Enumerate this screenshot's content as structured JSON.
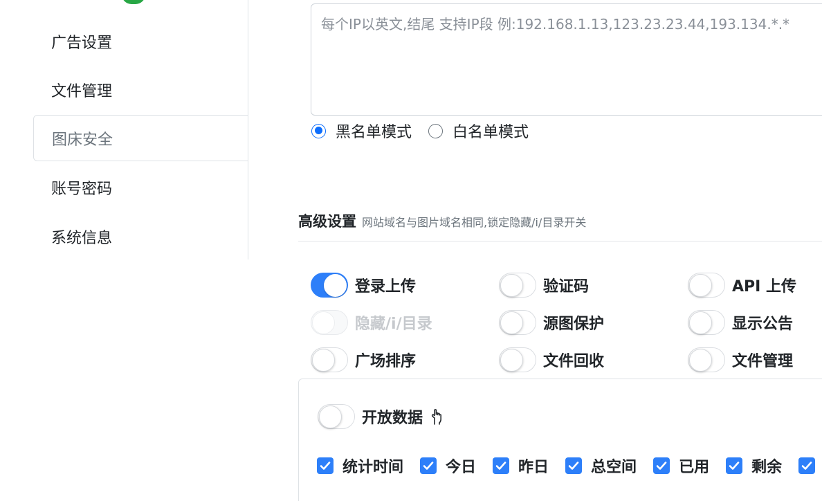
{
  "sidebar": {
    "items": [
      {
        "label": "广告设置"
      },
      {
        "label": "文件管理"
      },
      {
        "label": "图床安全",
        "active": true
      },
      {
        "label": "账号密码"
      },
      {
        "label": "系统信息"
      }
    ]
  },
  "ip_blacklist": {
    "placeholder": "每个IP以英文,结尾 支持IP段 例:192.168.1.13,123.23.23.44,193.134.*.*",
    "value": ""
  },
  "list_mode": {
    "options": [
      {
        "label": "黑名单模式",
        "checked": true
      },
      {
        "label": "白名单模式",
        "checked": false
      }
    ]
  },
  "advanced": {
    "title": "高级设置",
    "subtitle": "网站域名与图片域名相同,锁定隐藏/i/目录开关",
    "switches": [
      {
        "label": "登录上传",
        "on": true,
        "disabled": false
      },
      {
        "label": "验证码",
        "on": false,
        "disabled": false
      },
      {
        "label": "API 上传",
        "on": false,
        "disabled": false
      },
      {
        "label": "隐藏/i/目录",
        "on": false,
        "disabled": true
      },
      {
        "label": "源图保护",
        "on": false,
        "disabled": false
      },
      {
        "label": "显示公告",
        "on": false,
        "disabled": false
      },
      {
        "label": "广场排序",
        "on": false,
        "disabled": false
      },
      {
        "label": "文件回收",
        "on": false,
        "disabled": false
      },
      {
        "label": "文件管理",
        "on": false,
        "disabled": false
      }
    ]
  },
  "open_data": {
    "label": "开放数据",
    "on": false,
    "icon": "pointer-hand-icon",
    "checkboxes": [
      {
        "label": "统计时间",
        "checked": true
      },
      {
        "label": "今日",
        "checked": true
      },
      {
        "label": "昨日",
        "checked": true
      },
      {
        "label": "总空间",
        "checked": true
      },
      {
        "label": "已用",
        "checked": true
      },
      {
        "label": "剩余",
        "checked": true
      },
      {
        "label": "",
        "checked": true
      }
    ]
  },
  "colors": {
    "accent": "#2d7ff9",
    "radio_accent": "#0d6efd",
    "badge": "#28a745",
    "border": "#dee2e6"
  }
}
